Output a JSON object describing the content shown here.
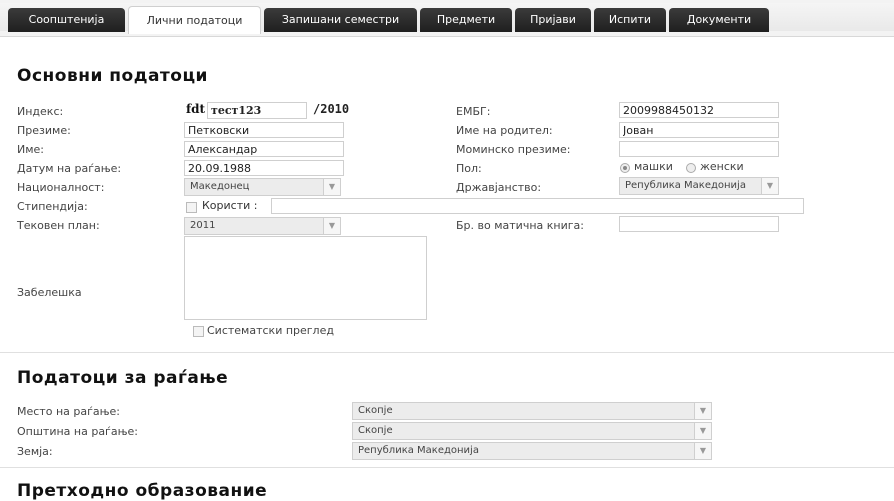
{
  "tabs": [
    "Соопштенија",
    "Лични податоци",
    "Запишани семестри",
    "Предмети",
    "Пријави",
    "Испити",
    "Документи"
  ],
  "active_tab": "Лични податоци",
  "section_basic": {
    "title": "Основни податоци",
    "index_label": "Индекс:",
    "index_prefix": "fdt",
    "index_value": "тест123",
    "index_year": "/2010",
    "surname_label": "Презиме:",
    "surname_value": "Петковски",
    "name_label": "Име:",
    "name_value": "Александар",
    "dob_label": "Датум на раѓање:",
    "dob_value": "20.09.1988",
    "nationality_label": "Националност:",
    "nationality_value": "Македонец",
    "scholarship_label": "Стипендија:",
    "scholarship_uses": "Користи :",
    "scholarship_value": "",
    "plan_label": "Тековен план:",
    "plan_value": "2011",
    "note_label": "Забелешка",
    "note_value": "",
    "systematic_label": "Систематски преглед",
    "embg_label": "ЕМБГ:",
    "embg_value": "2009988450132",
    "parent_label": "Име на родител:",
    "parent_value": "Јован",
    "maiden_label": "Моминско презиме:",
    "maiden_value": "",
    "gender_label": "Пол:",
    "gender_male": "машки",
    "gender_female": "женски",
    "citizenship_label": "Државјанство:",
    "citizenship_value": "Република Македонија",
    "registry_label": "Бр. во матична книга:",
    "registry_value": ""
  },
  "section_birth": {
    "title": "Податоци за раѓање",
    "place_label": "Место на раѓање:",
    "place_value": "Скопје",
    "municipality_label": "Општина на раѓање:",
    "municipality_value": "Скопје",
    "country_label": "Земја:",
    "country_value": "Република Македонија"
  },
  "section_prev": {
    "title": "Претходно образование"
  }
}
